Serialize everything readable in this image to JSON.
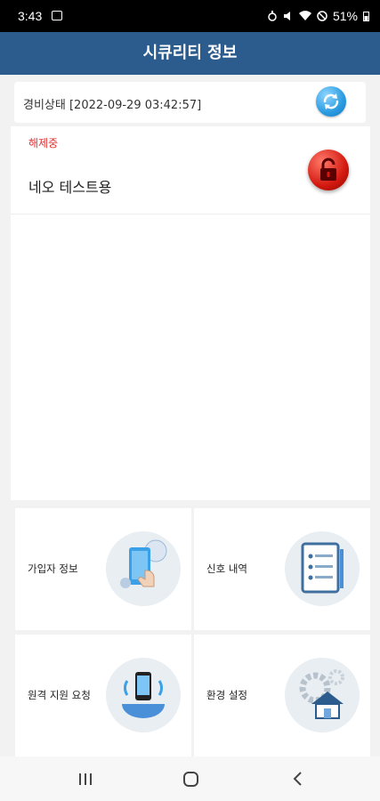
{
  "status_bar": {
    "time": "3:43",
    "battery": "51%"
  },
  "app_bar": {
    "title": "시큐리티 정보"
  },
  "security": {
    "label": "경비상태 [2022-09-29 03:42:57]"
  },
  "site": {
    "status": "해제중",
    "name": "네오 테스트용"
  },
  "menu": {
    "member_info": "가입자 정보",
    "signal_history": "신호 내역",
    "remote_support": "원격 지원 요청",
    "settings": "환경 설정"
  },
  "colors": {
    "app_bar": "#2c5b8d",
    "status_red": "#e03030",
    "refresh": "#2a9be0",
    "lock": "#d41a10"
  },
  "icons": {
    "refresh": "refresh-icon",
    "lock": "lock-icon",
    "member_info": "phone-touch-icon",
    "signal_history": "notebook-list-icon",
    "remote_support": "phone-signal-icon",
    "settings": "gear-house-icon"
  }
}
